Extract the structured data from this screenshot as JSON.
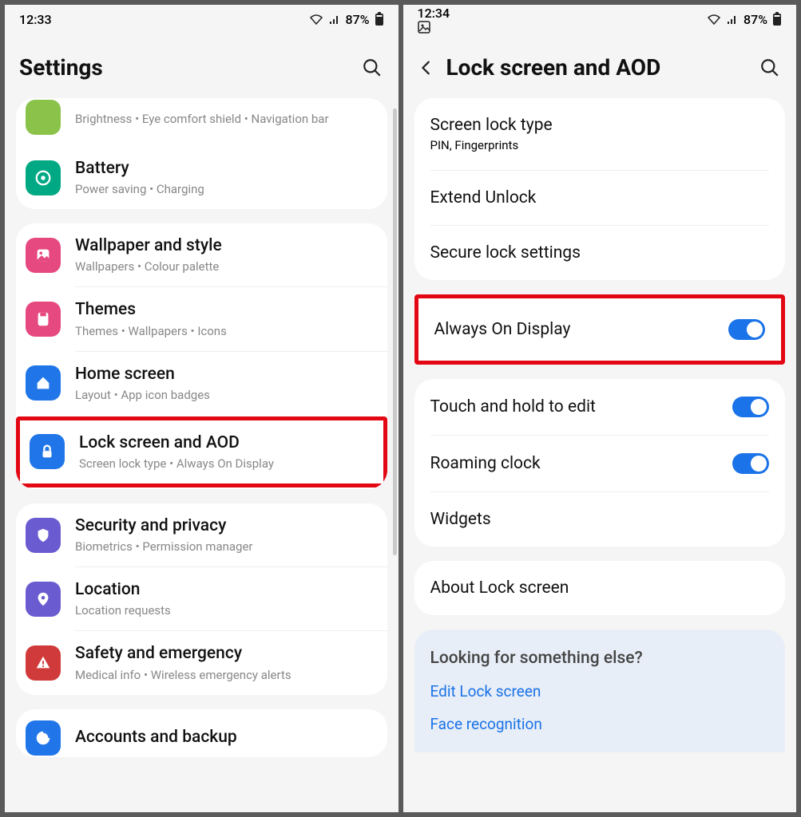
{
  "left": {
    "status": {
      "time": "12:33",
      "battery": "87%"
    },
    "title": "Settings",
    "items": [
      {
        "title": "",
        "sub": "Brightness  •  Eye comfort shield  •  Navigation bar",
        "icon": "display",
        "partial": "top"
      },
      {
        "title": "Battery",
        "sub": "Power saving  •  Charging",
        "icon": "battery",
        "color": "#00a884"
      },
      null,
      {
        "title": "Wallpaper and style",
        "sub": "Wallpapers  •  Colour palette",
        "icon": "wallpaper",
        "color": "#e64980"
      },
      {
        "title": "Themes",
        "sub": "Themes  •  Wallpapers  •  Icons",
        "icon": "themes",
        "color": "#e64980"
      },
      {
        "title": "Home screen",
        "sub": "Layout  •  App icon badges",
        "icon": "home",
        "color": "#2076e8"
      },
      {
        "title": "Lock screen and AOD",
        "sub": "Screen lock type  •  Always On Display",
        "icon": "lock",
        "color": "#2076e8",
        "highlight": true
      },
      null,
      {
        "title": "Security and privacy",
        "sub": "Biometrics  •  Permission manager",
        "icon": "shield",
        "color": "#6b5bd1"
      },
      {
        "title": "Location",
        "sub": "Location requests",
        "icon": "location",
        "color": "#6b5bd1"
      },
      {
        "title": "Safety and emergency",
        "sub": "Medical info  •  Wireless emergency alerts",
        "icon": "alert",
        "color": "#d13a3a"
      },
      null,
      {
        "title": "Accounts and backup",
        "sub": "",
        "icon": "accounts",
        "color": "#2076e8",
        "partial": "bottom"
      }
    ]
  },
  "right": {
    "status": {
      "time": "12:34",
      "battery": "87%"
    },
    "title": "Lock screen and AOD",
    "group1": [
      {
        "title": "Screen lock type",
        "sub": "PIN, Fingerprints",
        "subBlue": true
      },
      {
        "title": "Extend Unlock"
      },
      {
        "title": "Secure lock settings"
      }
    ],
    "aod": {
      "title": "Always On Display",
      "toggle": true,
      "highlight": true
    },
    "group2": [
      {
        "title": "Touch and hold to edit",
        "toggle": true
      },
      {
        "title": "Roaming clock",
        "toggle": true
      },
      {
        "title": "Widgets"
      }
    ],
    "group3": [
      {
        "title": "About Lock screen"
      }
    ],
    "footer": {
      "heading": "Looking for something else?",
      "links": [
        "Edit Lock screen",
        "Face recognition"
      ]
    }
  }
}
